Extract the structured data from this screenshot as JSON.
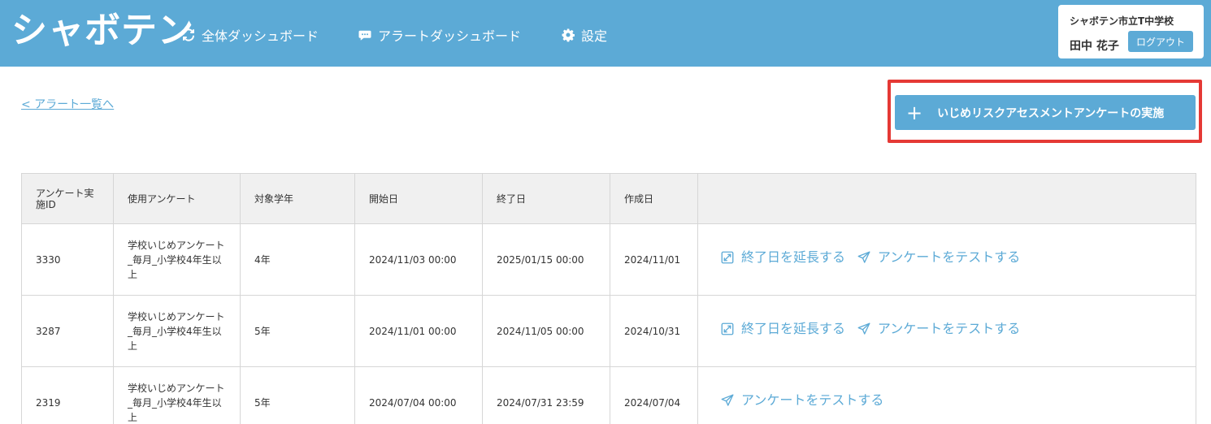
{
  "header": {
    "logo": "シャボテン",
    "nav": [
      {
        "label": "全体ダッシュボード",
        "icon": "sync-icon"
      },
      {
        "label": "アラートダッシュボード",
        "icon": "chat-bubble-icon"
      },
      {
        "label": "設定",
        "icon": "gear-icon"
      }
    ],
    "user": {
      "school": "シャボテン市立T中学校",
      "name": "田中 花子",
      "logout_label": "ログアウト"
    }
  },
  "back_link": "< アラート一覧へ",
  "primary_button": {
    "label": "いじめリスクアセスメントアンケートの実施",
    "icon": "plus-icon"
  },
  "table": {
    "headers": [
      "アンケート実施ID",
      "使用アンケート",
      "対象学年",
      "開始日",
      "終了日",
      "作成日",
      ""
    ],
    "rows": [
      {
        "id": "3330",
        "survey": "学校いじめアンケート_毎月_小学校4年生以上",
        "grade": "4年",
        "start": "2024/11/03 00:00",
        "end": "2025/01/15 00:00",
        "created": "2024/11/01",
        "extend_label": "終了日を延長する",
        "test_label": "アンケートをテストする"
      },
      {
        "id": "3287",
        "survey": "学校いじめアンケート_毎月_小学校4年生以上",
        "grade": "5年",
        "start": "2024/11/01 00:00",
        "end": "2024/11/05 00:00",
        "created": "2024/10/31",
        "extend_label": "終了日を延長する",
        "test_label": "アンケートをテストする"
      },
      {
        "id": "2319",
        "survey": "学校いじめアンケート_毎月_小学校4年生以上",
        "grade": "5年",
        "start": "2024/07/04 00:00",
        "end": "2024/07/31 23:59",
        "created": "2024/07/04",
        "extend_label": "",
        "test_label": "アンケートをテストする"
      }
    ]
  },
  "colors": {
    "brand": "#5caad6",
    "highlight": "#e53935",
    "header_bg": "#f0f0f0",
    "border": "#d6d6d6"
  }
}
